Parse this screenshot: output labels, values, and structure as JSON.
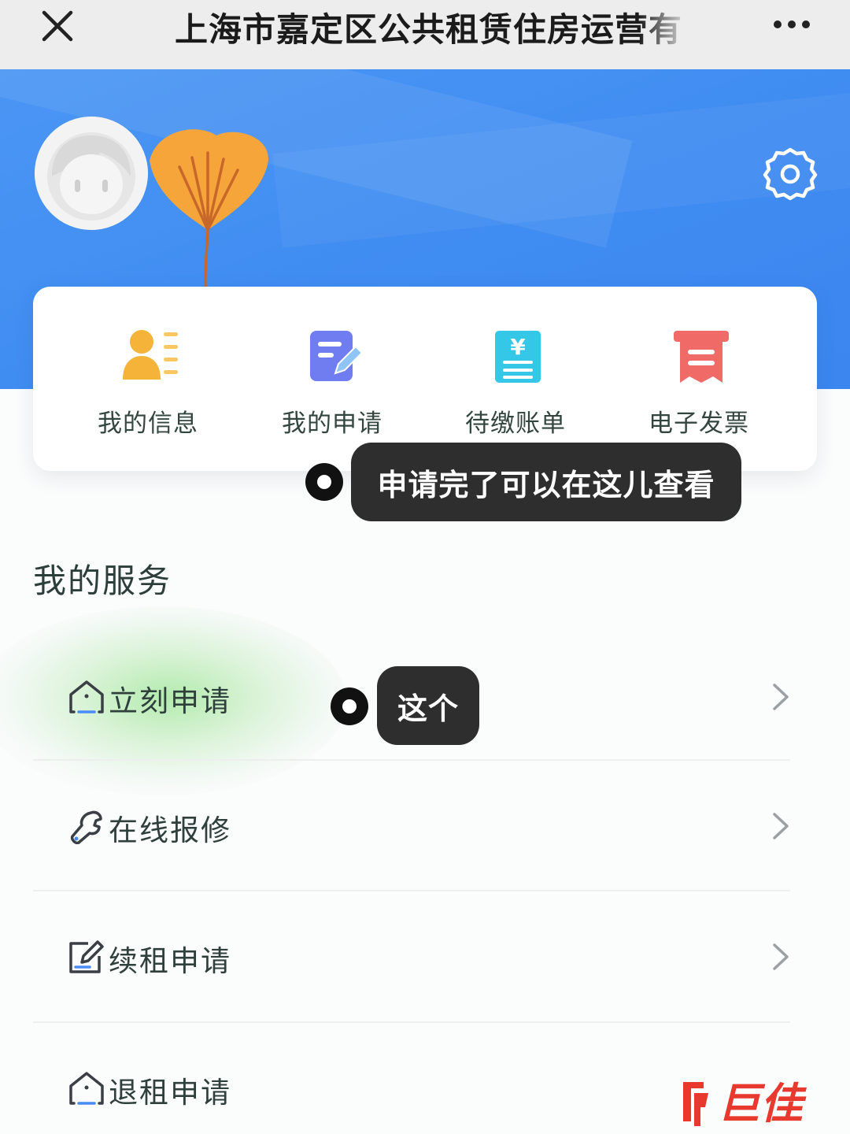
{
  "titlebar": {
    "title": "上海市嘉定区公共租赁住房运营有",
    "close_icon": "close-icon",
    "more_icon": "more-icon"
  },
  "profile": {
    "avatar_icon": "avatar-icon",
    "decoration_icon": "ginkgo-leaf-icon",
    "settings_icon": "gear-icon"
  },
  "quick_actions": [
    {
      "label": "我的信息",
      "icon": "user-info-icon",
      "color": "#f5b33a"
    },
    {
      "label": "我的申请",
      "icon": "edit-document-icon",
      "color": "#6f7df0"
    },
    {
      "label": "待缴账单",
      "icon": "bill-icon",
      "color": "#35c7e8"
    },
    {
      "label": "电子发票",
      "icon": "invoice-icon",
      "color": "#f06a68"
    }
  ],
  "tooltips": {
    "applications_tip": "申请完了可以在这儿查看",
    "apply_now_tip": "这个"
  },
  "services": {
    "title": "我的服务",
    "items": [
      {
        "label": "立刻申请",
        "icon": "house-icon"
      },
      {
        "label": "在线报修",
        "icon": "wrench-icon"
      },
      {
        "label": "续租申请",
        "icon": "edit-icon"
      },
      {
        "label": "退租申请",
        "icon": "house-icon"
      }
    ]
  },
  "watermark": {
    "text": "巨佳",
    "color": "#e8392e"
  },
  "colors": {
    "header_blue": "#3f8cf2",
    "card_bg": "#ffffff",
    "tooltip_bg": "#2e2e2e"
  }
}
